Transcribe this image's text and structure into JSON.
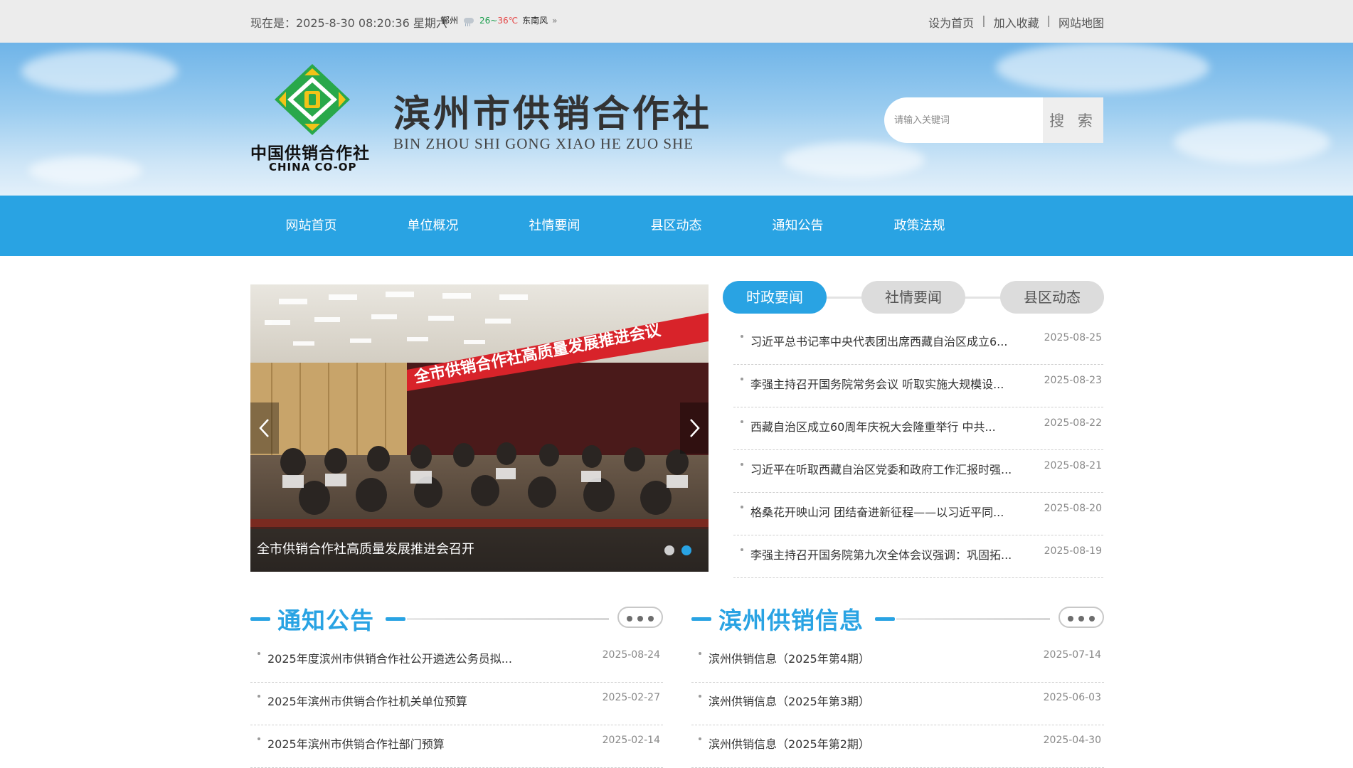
{
  "topbar": {
    "datetime": "现在是：2025-8-30 08:20:36 星期六",
    "city": "鄞州",
    "temp_low": "26",
    "temp_sep": "~",
    "temp_high": "36℃",
    "wind": "东南风",
    "more": "»",
    "links": [
      "设为首页",
      "加入收藏",
      "网站地图"
    ],
    "sep": "|"
  },
  "header": {
    "logo_cn": "中国供销合作社",
    "logo_en": "CHINA CO-OP",
    "title": "滨州市供销合作社",
    "subtitle": "BIN ZHOU SHI GONG XIAO HE ZUO SHE",
    "search_placeholder": "请输入关键词",
    "search_button": "搜 索",
    "colors": {
      "logo_green": "#29a84a",
      "logo_yellow": "#f2c318"
    }
  },
  "nav": [
    "网站首页",
    "单位概况",
    "社情要闻",
    "县区动态",
    "通知公告",
    "政策法规"
  ],
  "slider": {
    "caption": "全市供销合作社高质量发展推进会召开",
    "banner_text": "全市供销合作社高质量发展推进会议",
    "slide_count": 2,
    "active_index": 1
  },
  "news": {
    "tabs": [
      "时政要闻",
      "社情要闻",
      "县区动态"
    ],
    "active_tab": 0,
    "items": [
      {
        "title": "习近平总书记率中央代表团出席西藏自治区成立6...",
        "date": "2025-08-25"
      },
      {
        "title": "李强主持召开国务院常务会议 听取实施大规模设...",
        "date": "2025-08-23"
      },
      {
        "title": "西藏自治区成立60周年庆祝大会隆重举行 中共...",
        "date": "2025-08-22"
      },
      {
        "title": "习近平在听取西藏自治区党委和政府工作汇报时强...",
        "date": "2025-08-21"
      },
      {
        "title": "格桑花开映山河 团结奋进新征程——以习近平同...",
        "date": "2025-08-20"
      },
      {
        "title": "李强主持召开国务院第九次全体会议强调：巩固拓...",
        "date": "2025-08-19"
      }
    ]
  },
  "notices": {
    "title": "通知公告",
    "items": [
      {
        "title": "2025年度滨州市供销合作社公开遴选公务员拟...",
        "date": "2025-08-24"
      },
      {
        "title": "2025年滨州市供销合作社机关单位预算",
        "date": "2025-02-27"
      },
      {
        "title": "2025年滨州市供销合作社部门预算",
        "date": "2025-02-14"
      }
    ]
  },
  "supply_info": {
    "title": "滨州供销信息",
    "items": [
      {
        "title": "滨州供销信息（2025年第4期）",
        "date": "2025-07-14"
      },
      {
        "title": "滨州供销信息（2025年第3期）",
        "date": "2025-06-03"
      },
      {
        "title": "滨州供销信息（2025年第2期）",
        "date": "2025-04-30"
      }
    ]
  },
  "colors": {
    "accent": "#29a3e3",
    "topbar_bg": "#ececec"
  }
}
